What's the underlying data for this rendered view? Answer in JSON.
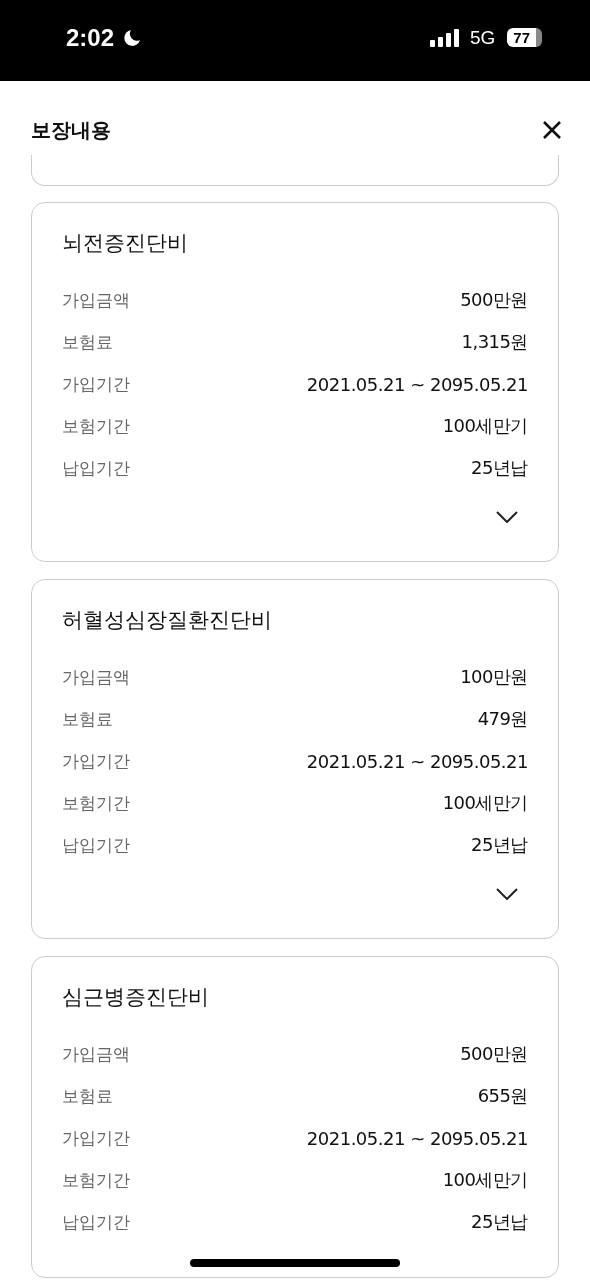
{
  "status_bar": {
    "time": "2:02",
    "network": "5G",
    "battery": "77"
  },
  "header": {
    "title": "보장내용"
  },
  "cards": [
    {
      "title": "뇌전증진단비",
      "expanded": false,
      "rows": [
        {
          "label": "가입금액",
          "value": "500만원"
        },
        {
          "label": "보험료",
          "value": "1,315원"
        },
        {
          "label": "가입기간",
          "value": "2021.05.21 ~ 2095.05.21"
        },
        {
          "label": "보험기간",
          "value": "100세만기"
        },
        {
          "label": "납입기간",
          "value": "25년납"
        }
      ]
    },
    {
      "title": "허혈성심장질환진단비",
      "expanded": false,
      "rows": [
        {
          "label": "가입금액",
          "value": "100만원"
        },
        {
          "label": "보험료",
          "value": "479원"
        },
        {
          "label": "가입기간",
          "value": "2021.05.21 ~ 2095.05.21"
        },
        {
          "label": "보험기간",
          "value": "100세만기"
        },
        {
          "label": "납입기간",
          "value": "25년납"
        }
      ]
    },
    {
      "title": "심근병증진단비",
      "rows": [
        {
          "label": "가입금액",
          "value": "500만원"
        },
        {
          "label": "보험료",
          "value": "655원"
        },
        {
          "label": "가입기간",
          "value": "2021.05.21 ~ 2095.05.21"
        },
        {
          "label": "보험기간",
          "value": "100세만기"
        },
        {
          "label": "납입기간",
          "value": "25년납"
        }
      ]
    }
  ]
}
